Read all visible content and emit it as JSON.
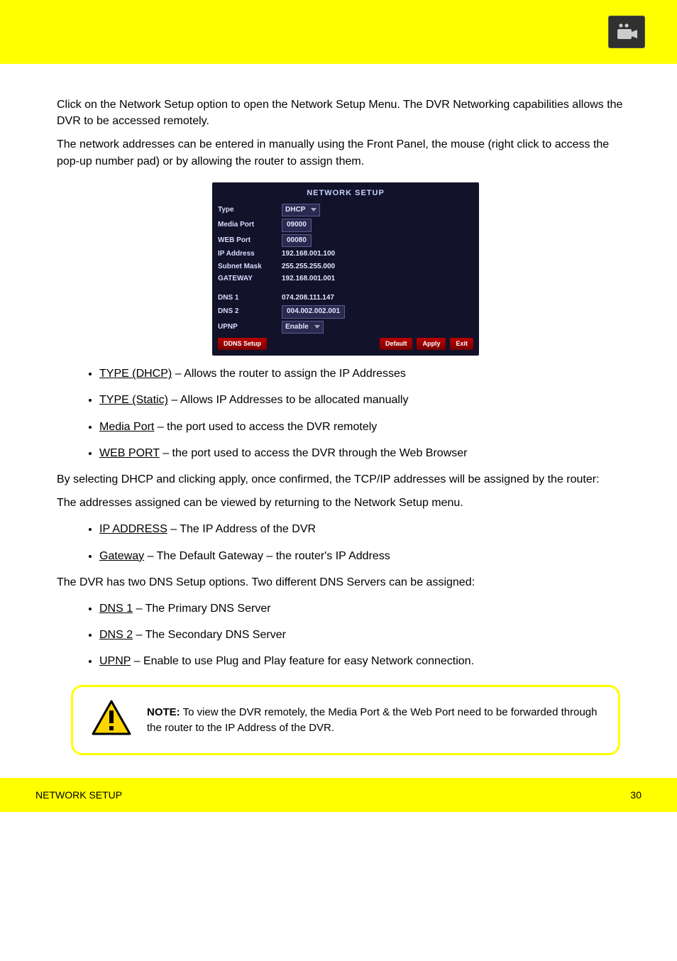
{
  "header": {
    "icon": "camera-icon"
  },
  "intro": {
    "p1": "Click on the Network Setup option to open the Network Setup Menu. The DVR Networking capabilities allows the DVR to be accessed remotely.",
    "p2": "The network addresses can be entered in manually using the Front Panel, the mouse (right click to access the pop-up number pad) or by allowing the router to assign them."
  },
  "screenshot": {
    "title": "NETWORK  SETUP",
    "rows": {
      "type_label": "Type",
      "type_value": "DHCP",
      "media_port_label": "Media  Port",
      "media_port_value": "09000",
      "web_port_label": "WEB  Port",
      "web_port_value": "00080",
      "ip_label": "IP  Address",
      "ip_value": "192.168.001.100",
      "subnet_label": "Subnet  Mask",
      "subnet_value": "255.255.255.000",
      "gateway_label": "GATEWAY",
      "gateway_value": "192.168.001.001",
      "dns1_label": "DNS  1",
      "dns1_value": "074.208.111.147",
      "dns2_label": "DNS  2",
      "dns2_value": "004.002.002.001",
      "upnp_label": "UPNP",
      "upnp_value": "Enable"
    },
    "buttons": {
      "ddns": "DDNS   Setup",
      "default": "Default",
      "apply": "Apply",
      "exit": "Exit"
    }
  },
  "list1": {
    "li1a": "TYPE (DHCP)",
    "li1b": " – Allows the router to assign the IP Addresses",
    "li2a": "TYPE (Static)",
    "li2b": " – Allows IP Addresses to be allocated manually",
    "li3a": "Media Port",
    "li3b": " – the port used to access the DVR remotely",
    "li4a": "WEB PORT",
    "li4b": " – the port used to access the DVR through the Web Browser"
  },
  "mid": {
    "p3": "By selecting DHCP and clicking apply, once confirmed, the TCP/IP addresses will be assigned by the router:",
    "p4": "The addresses assigned can be viewed by returning to the Network Setup menu."
  },
  "list2": {
    "li1a": "IP ADDRESS",
    "li1b": " – The IP Address of the DVR",
    "li2a": "Gateway",
    "li2b": " – The Default Gateway – the ",
    "li2c": "router's IP Address"
  },
  "mid2": {
    "p5": "The DVR has two DNS Setup options. Two different DNS Servers can be assigned:"
  },
  "list3": {
    "li1a": "DNS 1",
    "li1b": " – The Primary DNS Server",
    "li2a": "DNS 2",
    "li2b": " – The Secondary DNS Server",
    "li3a": "UPNP",
    "li3b": " – Enable to use Plug and Play feature for easy Network connection."
  },
  "note": {
    "b": "NOTE:",
    "t": " To view the DVR remotely, the Media Port & the Web Port need to be forwarded through the router to the IP Address of the DVR."
  },
  "footer": {
    "left": "NETWORK SETUP",
    "right": "30"
  }
}
